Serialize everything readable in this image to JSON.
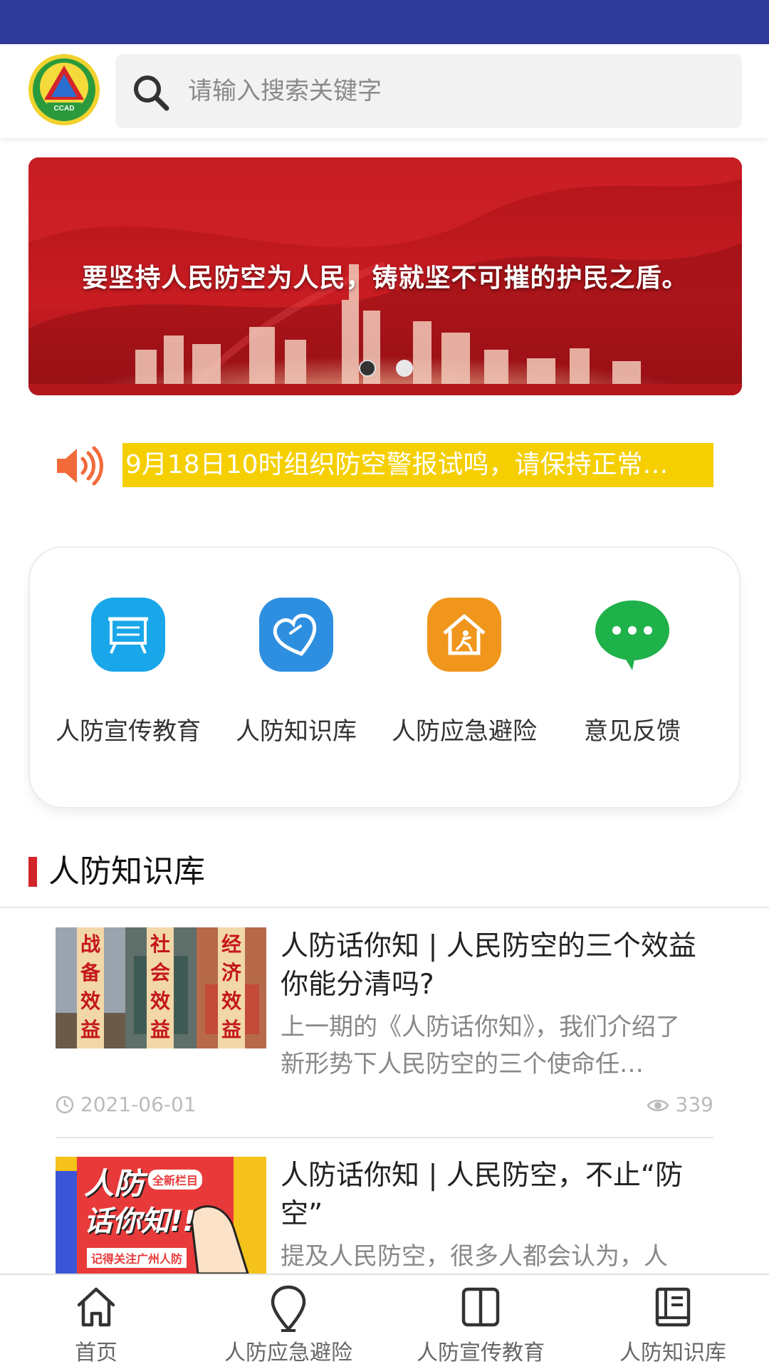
{
  "header": {
    "logo_text": "CCAD",
    "search_placeholder": "请输入搜索关键字"
  },
  "banner": {
    "slogan": "要坚持人民防空为人民，铸就坚不可摧的护民之盾。",
    "slide_count": 2,
    "active_slide": 1
  },
  "notice": {
    "text": "9月18日10时组织防空警报试鸣，请保持正常…"
  },
  "quick_entries": [
    {
      "label": "人防宣传教育",
      "icon": "presentation-board-icon",
      "color": "#1aa7ea"
    },
    {
      "label": "人防知识库",
      "icon": "heart-icon",
      "color": "#2e8fe0"
    },
    {
      "label": "人防应急避险",
      "icon": "shelter-house-icon",
      "color": "#f0961c"
    },
    {
      "label": "意见反馈",
      "icon": "chat-bubble-icon",
      "color": "#1fb14a"
    }
  ],
  "section": {
    "title": "人防知识库"
  },
  "articles": [
    {
      "title": "人防话你知 | 人民防空的三个效益你能分清吗?",
      "summary": "上一期的《人防话你知》，我们介绍了新形势下人民防空的三个使命任…",
      "date": "2021-06-01",
      "views": "339",
      "thumb_words": [
        "战备效益",
        "社会效益",
        "经济效益"
      ]
    },
    {
      "title": "人防话你知 | 人民防空，不止“防空”",
      "summary": "提及人民防空，很多人都会认为，人",
      "thumb_text_1": "人防",
      "thumb_text_2": "话你知!!",
      "thumb_tag": "全新栏目",
      "thumb_footer": "记得关注广州人防"
    }
  ],
  "tabbar": [
    {
      "label": "首页",
      "icon": "home-icon"
    },
    {
      "label": "人防应急避险",
      "icon": "location-pin-icon"
    },
    {
      "label": "人防宣传教育",
      "icon": "book-open-icon"
    },
    {
      "label": "人防知识库",
      "icon": "library-icon"
    }
  ],
  "colors": {
    "status_bar": "#2f3a9a",
    "accent_red": "#d3242a",
    "notice_bg": "#f5cf00"
  }
}
